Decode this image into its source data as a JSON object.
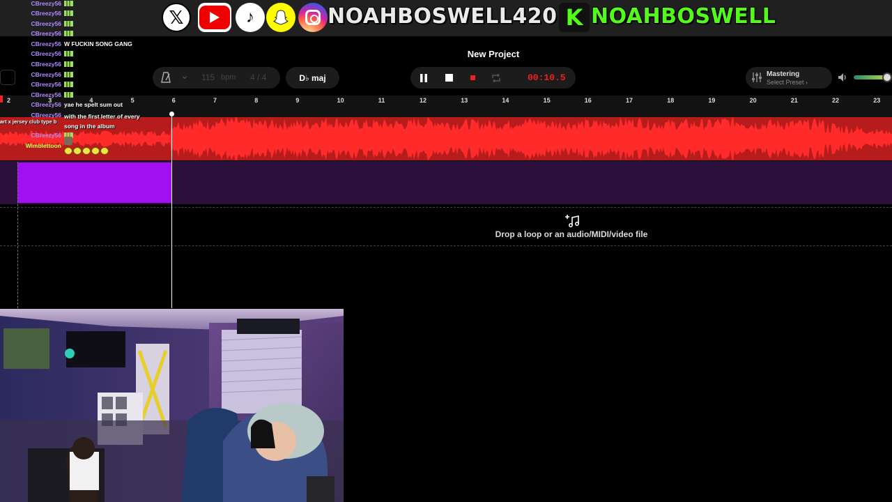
{
  "banner": {
    "icons": [
      "x-logo-icon",
      "youtube-icon",
      "tiktok-icon",
      "snapchat-icon",
      "instagram-icon",
      "kick-logo-icon"
    ],
    "x_glyph": "𝕏",
    "tiktok_glyph": "♪",
    "snap_glyph": "👻",
    "kick_glyph": "K",
    "handle_main": "NOAHBOSWELL420",
    "handle_kick": "NOAHBOSWELL"
  },
  "daw": {
    "project_title": "New Project",
    "tempo": {
      "bpm": "115",
      "unit": "bpm",
      "time_signature": "4 / 4"
    },
    "key": "D♭ maj",
    "transport": {
      "time": "00:10.5"
    },
    "mastering": {
      "label": "Mastering",
      "preset": "Select Preset ›"
    },
    "ruler_ticks": [
      "2",
      "3",
      "4",
      "5",
      "6",
      "7",
      "8",
      "9",
      "10",
      "11",
      "12",
      "13",
      "14",
      "15",
      "16",
      "17",
      "18",
      "19",
      "20",
      "21",
      "22",
      "23"
    ],
    "drop_zone": {
      "text": "Drop a loop or an audio/MIDI/video file"
    },
    "colors": {
      "audio_track": "#b71c1c",
      "waveform": "#ff2a2a",
      "midi_clip": "#a20ff0",
      "midi_track": "#2a103a",
      "time": "#e22222"
    }
  },
  "chat": {
    "messages": [
      {
        "user": "CBreezy56",
        "text": ""
      },
      {
        "user": "CBreezy56",
        "text": ""
      },
      {
        "user": "CBreezy56",
        "text": ""
      },
      {
        "user": "CBreezy56",
        "text": ""
      },
      {
        "user": "CBreezy56",
        "text": "W FUCKIN SONG GANG"
      },
      {
        "user": "CBreezy56",
        "text": ""
      },
      {
        "user": "CBreezy56",
        "text": ""
      },
      {
        "user": "CBreezy56",
        "text": ""
      },
      {
        "user": "CBreezy56",
        "text": ""
      },
      {
        "user": "CBreezy56",
        "text": ""
      },
      {
        "user": "CBreezy56",
        "text": "yae he spelt sum out"
      },
      {
        "user": "CBreezy56",
        "text": "with the first letter of every song in the album"
      },
      {
        "user": "CBreezy56",
        "text": ""
      },
      {
        "user": "Wimblettoon",
        "text": ""
      }
    ],
    "overlap_text": "art x jersey club type b"
  }
}
